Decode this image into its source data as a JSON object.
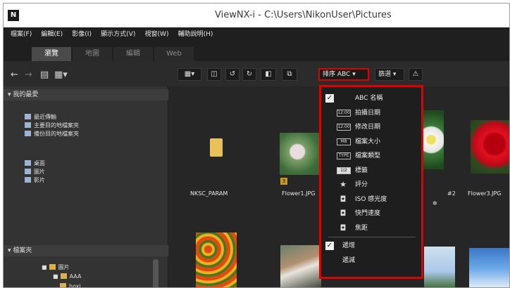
{
  "window": {
    "app_icon": "N",
    "title": "ViewNX-i - C:\\Users\\NikonUser\\Pictures"
  },
  "menu": [
    "檔案(F)",
    "編輯(E)",
    "影像(I)",
    "顯示方式(V)",
    "視窗(W)",
    "輔助說明(H)"
  ],
  "tabs": [
    "瀏覽",
    "地圖",
    "編輯",
    "Web"
  ],
  "left_panel": {
    "nav_icons": [
      "back-arrow-icon",
      "forward-arrow-icon",
      "grid-view-icon",
      "list-view-icon"
    ],
    "favorites_header": "我的最愛",
    "favorites": [
      "最近傳輸",
      "主要目的地檔案夾",
      "備份目的地檔案夾"
    ],
    "places": [
      "桌面",
      "圖片",
      "影片"
    ],
    "folders_header": "檔案夾",
    "tree": [
      "圖片",
      "AAA",
      "hoxi"
    ]
  },
  "toolbar": {
    "sort_label": "排序 ABC",
    "filter_label": "篩選",
    "view_buttons": [
      "▦▾",
      "◫",
      "↺",
      "↻",
      "◧",
      "⧉"
    ]
  },
  "thumbnails": [
    {
      "caption": "NKSC_PARAM",
      "kind": "folder"
    },
    {
      "caption": "Flower1.JPG",
      "badge": "3",
      "kind": "photo"
    },
    {
      "caption": "Flower3.JPG",
      "badge": "#2",
      "kind": "photo"
    }
  ],
  "sort_menu": {
    "items": [
      {
        "icon": "ABC",
        "label": "名稱",
        "checked": true
      },
      {
        "icon": "12:00",
        "label": "拍攝日期",
        "checked": false
      },
      {
        "icon": "12:00",
        "label": "修改日期",
        "checked": false
      },
      {
        "icon": "MB",
        "label": "檔案大小",
        "checked": false
      },
      {
        "icon": "TYPE",
        "label": "檔案類型",
        "checked": false
      },
      {
        "icon": "1|2",
        "label": "標籤",
        "checked": false
      },
      {
        "icon": "★",
        "label": "評分",
        "checked": false
      },
      {
        "icon": "camera",
        "label": "ISO 感光度",
        "checked": false
      },
      {
        "icon": "camera",
        "label": "快門速度",
        "checked": false
      },
      {
        "icon": "camera",
        "label": "焦距",
        "checked": false
      }
    ],
    "order": [
      {
        "label": "遞增",
        "checked": true
      },
      {
        "label": "遞減",
        "checked": false
      }
    ]
  },
  "colors": {
    "highlight": "#e00000",
    "bg": "#262626"
  }
}
